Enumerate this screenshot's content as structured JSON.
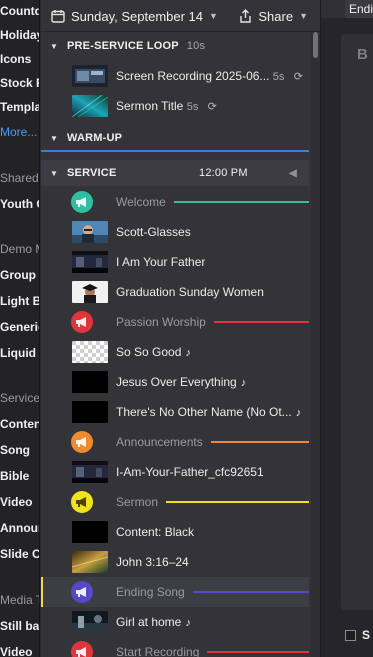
{
  "sidebar": {
    "items": [
      {
        "label": "Countdowns",
        "kind": "bold"
      },
      {
        "label": "Holiday",
        "kind": "bold"
      },
      {
        "label": "Icons",
        "kind": "bold"
      },
      {
        "label": "Stock Photos",
        "kind": "bold"
      },
      {
        "label": "Templates",
        "kind": "bold"
      },
      {
        "label": "More...",
        "kind": "link"
      },
      {
        "label": "Shared Groups",
        "kind": "head"
      },
      {
        "label": "Youth Group",
        "kind": "bold"
      },
      {
        "label": "Demo Media",
        "kind": "head"
      },
      {
        "label": "Group Up",
        "kind": "bold"
      },
      {
        "label": "Light Background",
        "kind": "bold"
      },
      {
        "label": "Generic",
        "kind": "bold"
      },
      {
        "label": "Liquid Colors",
        "kind": "bold"
      },
      {
        "label": "Service Items",
        "kind": "head"
      },
      {
        "label": "Content",
        "kind": "bold"
      },
      {
        "label": "Song",
        "kind": "bold"
      },
      {
        "label": "Bible",
        "kind": "bold"
      },
      {
        "label": "Video",
        "kind": "bold"
      },
      {
        "label": "Announcement",
        "kind": "bold"
      },
      {
        "label": "Slide Carousel",
        "kind": "bold"
      },
      {
        "label": "Media Types",
        "kind": "head"
      },
      {
        "label": "Still background",
        "kind": "bold"
      },
      {
        "label": "Video",
        "kind": "bold"
      }
    ]
  },
  "header": {
    "date": "Sunday, September 14",
    "share": "Share"
  },
  "sections": {
    "preservice": {
      "title": "PRE-SERVICE LOOP",
      "duration": "10s"
    },
    "warmup": {
      "title": "WARM-UP"
    },
    "service": {
      "title": "SERVICE",
      "time": "12:00 PM"
    }
  },
  "preservice_items": [
    {
      "label": "Screen Recording 2025-06...",
      "duration": "5s"
    },
    {
      "label": "Sermon Title",
      "duration": "5s"
    }
  ],
  "service_items": [
    {
      "type": "header",
      "label": "Welcome",
      "color": "#2fbfa0"
    },
    {
      "type": "item",
      "label": "Scott-Glasses",
      "thumb": "person"
    },
    {
      "type": "item",
      "label": "I Am Your Father",
      "thumb": "dark-scene"
    },
    {
      "type": "item",
      "label": "Graduation Sunday Women",
      "thumb": "graduate"
    },
    {
      "type": "header",
      "label": "Passion Worship",
      "color": "#e0353b"
    },
    {
      "type": "item",
      "label": "So So Good",
      "thumb": "checker",
      "song": true
    },
    {
      "type": "item",
      "label": "Jesus Over Everything",
      "thumb": "black",
      "song": true
    },
    {
      "type": "item",
      "label": "There's No Other Name (No Ot...",
      "thumb": "black",
      "song": true
    },
    {
      "type": "header",
      "label": "Announcements",
      "color": "#f08a2e"
    },
    {
      "type": "item",
      "label": "I-Am-Your-Father_cfc92651",
      "thumb": "dark-scene"
    },
    {
      "type": "header",
      "label": "Sermon",
      "color": "#f2e21c"
    },
    {
      "type": "item",
      "label": "Content: Black",
      "thumb": "black"
    },
    {
      "type": "item",
      "label": "John 3:16–24",
      "thumb": "golden"
    },
    {
      "type": "header",
      "label": "Ending Song",
      "color": "#5a46c9",
      "selected": true
    },
    {
      "type": "item",
      "label": "Girl at home",
      "thumb": "night",
      "song": true
    },
    {
      "type": "header",
      "label": "Start Recording",
      "color": "#e0353b"
    }
  ],
  "right_panel": {
    "title": "Endi",
    "panel_letter": "B",
    "checkbox_label": "S"
  },
  "colors": {
    "accent_blue": "#3d7be0",
    "selected_marker": "#f2d64b"
  }
}
